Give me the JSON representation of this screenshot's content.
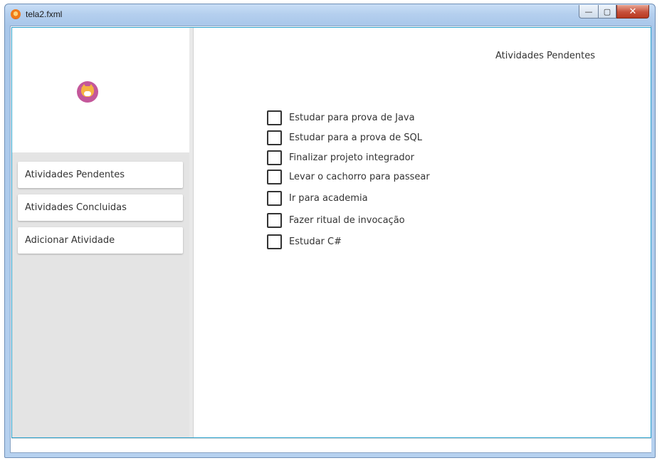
{
  "window": {
    "title": "tela2.fxml",
    "minimize_icon": "minimize-icon",
    "maximize_icon": "maximize-icon",
    "close_icon": "close-icon",
    "minimize_glyph": "—",
    "maximize_glyph": "▢",
    "close_glyph": "✕"
  },
  "sidebar": {
    "avatar_icon": "cat-avatar-icon",
    "items": [
      {
        "label": "Atividades Pendentes"
      },
      {
        "label": "Atividades Concluidas"
      },
      {
        "label": "Adicionar Atividade"
      }
    ]
  },
  "main": {
    "title": "Atividades Pendentes",
    "tasks": [
      {
        "label": "Estudar para prova de Java",
        "checked": false
      },
      {
        "label": "Estudar para a prova de SQL",
        "checked": false
      },
      {
        "label": "Finalizar projeto integrador",
        "checked": false
      },
      {
        "label": "Levar o cachorro para passear",
        "checked": false
      },
      {
        "label": "Ir para academia",
        "checked": false
      },
      {
        "label": "Fazer ritual de invocação",
        "checked": false
      },
      {
        "label": "Estudar C#",
        "checked": false
      }
    ]
  },
  "colors": {
    "scene_border": "#27a0cc",
    "sidebar_menu_bg": "#e4e4e4",
    "text": "#333333"
  }
}
